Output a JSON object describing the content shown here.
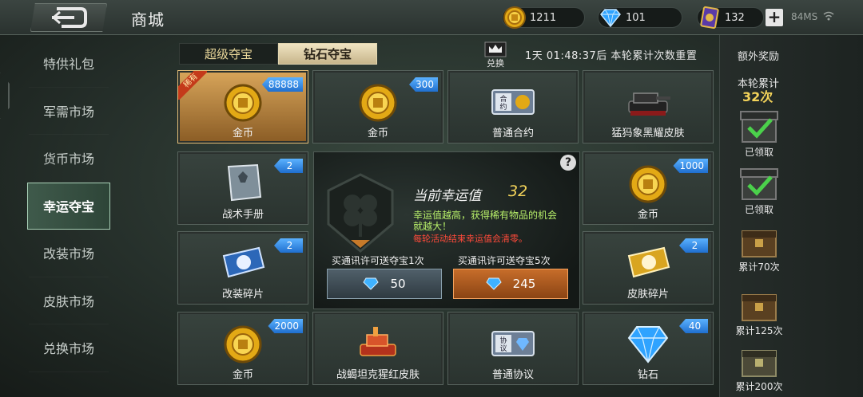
{
  "header": {
    "title": "商城"
  },
  "resources": [
    {
      "icon": "gold-coin-icon",
      "value": "1211"
    },
    {
      "icon": "diamond-icon",
      "value": "101"
    },
    {
      "icon": "card-ticket-icon",
      "value": "132"
    }
  ],
  "status": {
    "ms": "84MS"
  },
  "nav": [
    {
      "label": "特供礼包",
      "active": false
    },
    {
      "label": "军需市场",
      "active": false
    },
    {
      "label": "货币市场",
      "active": false
    },
    {
      "label": "幸运夺宝",
      "active": true
    },
    {
      "label": "改装市场",
      "active": false
    },
    {
      "label": "皮肤市场",
      "active": false
    },
    {
      "label": "兑换市场",
      "active": false
    }
  ],
  "tabs": [
    {
      "label": "超级夺宝",
      "active": false
    },
    {
      "label": "钻石夺宝",
      "active": true
    }
  ],
  "exchange_label": "兑换",
  "timer_text": "1天 01:48:37后 本轮累计次数重置",
  "items": [
    {
      "name": "金币",
      "badge": "88888",
      "rare": "稀有",
      "icon": "gold-coin-icon"
    },
    {
      "name": "金币",
      "badge": "300",
      "icon": "gold-coin-icon"
    },
    {
      "name": "普通合约",
      "badge": "",
      "icon": "contract-icon"
    },
    {
      "name": "猛犸象黑耀皮肤",
      "badge": "",
      "icon": "tank-skin-icon"
    },
    {
      "name": "战术手册",
      "badge": "2",
      "icon": "manual-book-icon"
    },
    {
      "name": "金币",
      "badge": "1000",
      "icon": "gold-coin-icon"
    },
    {
      "name": "改装碎片",
      "badge": "2",
      "icon": "mod-fragment-icon"
    },
    {
      "name": "皮肤碎片",
      "badge": "2",
      "icon": "skin-fragment-icon"
    },
    {
      "name": "金币",
      "badge": "2000",
      "icon": "gold-coin-icon"
    },
    {
      "name": "战蝎坦克猩红皮肤",
      "badge": "",
      "icon": "tank-skin-red-icon"
    },
    {
      "name": "普通协议",
      "badge": "",
      "icon": "protocol-icon"
    },
    {
      "name": "钻石",
      "badge": "40",
      "icon": "diamond-icon"
    }
  ],
  "luck": {
    "label": "当前幸运值",
    "value": "32",
    "desc": "幸运值越高，获得稀有物品的机会就越大！",
    "warn": "每轮活动结束幸运值会清零。",
    "help": "?"
  },
  "buy": [
    {
      "caption": "买通讯许可送夺宝1次",
      "price": "50"
    },
    {
      "caption": "买通讯许可送夺宝5次",
      "price": "245"
    }
  ],
  "extra": {
    "title": "额外奖励",
    "acc_label": "本轮累计",
    "acc_count": "32次",
    "rewards": [
      {
        "label": "已领取",
        "claimed": true
      },
      {
        "label": "已领取",
        "claimed": true
      },
      {
        "label": "累计70次",
        "claimed": false
      },
      {
        "label": "累计125次",
        "claimed": false
      },
      {
        "label": "累计200次",
        "claimed": false
      }
    ]
  },
  "colors": {
    "accent_gold": "#f3d35a",
    "badge_blue": "#2f86e6",
    "buy_orange": "#c76d2a",
    "warn_red": "#ff4a3a",
    "desc_green": "#b8f06a"
  }
}
